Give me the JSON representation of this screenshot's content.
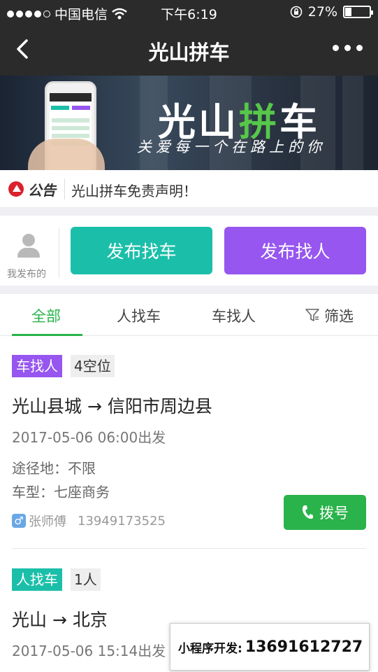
{
  "status_bar": {
    "carrier": "中国电信",
    "time": "下午6:19",
    "battery": "27%",
    "battery_level": 0.27
  },
  "nav": {
    "title": "光山拼车"
  },
  "banner": {
    "title_part1": "光山",
    "title_accent": "拼",
    "title_part2": "车",
    "slogan": "关爱每一个在路上的你"
  },
  "notice": {
    "tag": "公告",
    "text": "光山拼车免责声明！"
  },
  "publish": {
    "my_label": "我发布的",
    "find_car": "发布找车",
    "find_person": "发布找人"
  },
  "tabs": [
    {
      "label": "全部",
      "active": true
    },
    {
      "label": "人找车",
      "active": false
    },
    {
      "label": "车找人",
      "active": false
    },
    {
      "label": "筛选",
      "active": false
    }
  ],
  "trips": [
    {
      "type": "车找人",
      "seats": "4空位",
      "route_from": "光山县城",
      "route_to": "信阳市周边县",
      "datetime": "2017-05-06 06:00出发",
      "via": "途径地：不限",
      "car_model": "车型：七座商务",
      "driver": "张师傅",
      "phone": "13949173525",
      "dial": "拨号"
    },
    {
      "type": "人找车",
      "seats": "1人",
      "route_from": "光山",
      "route_to": "北京",
      "datetime": "2017-05-06 15:14出发"
    }
  ],
  "float_ad": {
    "label": "小程序开发:",
    "number": "13691612727"
  },
  "colors": {
    "green": "#29b34a",
    "teal": "#1bbfa9",
    "purple": "#9656ef",
    "dark": "#2b2b2b"
  }
}
